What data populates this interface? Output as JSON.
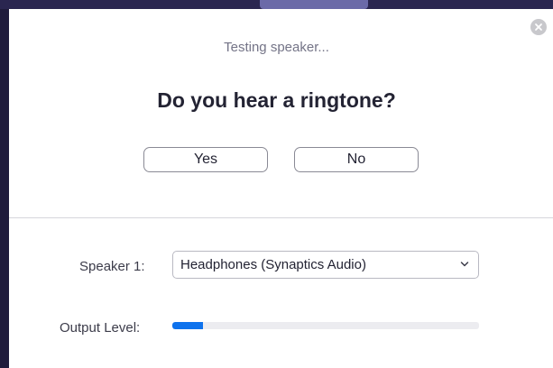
{
  "dialog": {
    "status_text": "Testing speaker...",
    "question": "Do you hear a ringtone?",
    "yes_label": "Yes",
    "no_label": "No",
    "close_icon": "close-icon"
  },
  "speaker": {
    "label": "Speaker 1:",
    "selected_device": "Headphones (Synaptics Audio)",
    "dropdown_icon": "chevron-down-icon"
  },
  "output_level": {
    "label": "Output Level:",
    "level_fraction": 0.1
  },
  "colors": {
    "accent": "#0e72ed",
    "backdrop": "#1f1b3b"
  }
}
